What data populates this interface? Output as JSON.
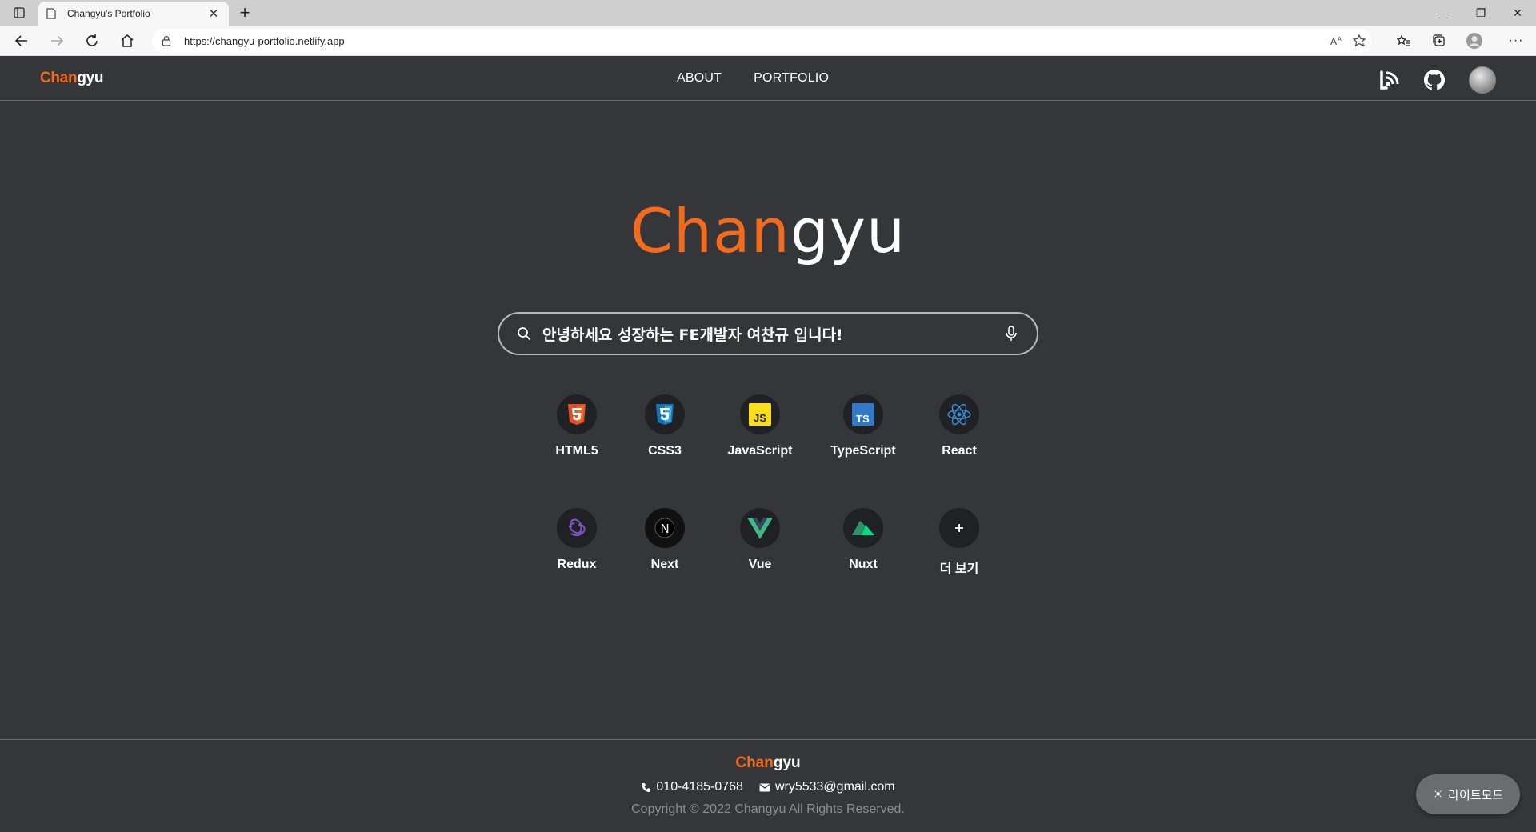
{
  "browser": {
    "tab_title": "Changyu's Portfolio",
    "url": "https://changyu-portfolio.netlify.app"
  },
  "header": {
    "logo_orange": "Chan",
    "logo_white": "gyu",
    "nav": [
      "ABOUT",
      "PORTFOLIO"
    ]
  },
  "hero": {
    "logo_orange": "Chan",
    "logo_white": "gyu",
    "search_value": "안녕하세요 성장하는 FE개발자 여찬규 입니다!"
  },
  "skills": [
    {
      "name": "HTML5",
      "icon": "html5-icon"
    },
    {
      "name": "CSS3",
      "icon": "css3-icon"
    },
    {
      "name": "JavaScript",
      "icon": "javascript-icon"
    },
    {
      "name": "TypeScript",
      "icon": "typescript-icon"
    },
    {
      "name": "React",
      "icon": "react-icon"
    },
    {
      "name": "Redux",
      "icon": "redux-icon"
    },
    {
      "name": "Next",
      "icon": "next-icon"
    },
    {
      "name": "Vue",
      "icon": "vue-icon"
    },
    {
      "name": "Nuxt",
      "icon": "nuxt-icon"
    },
    {
      "name": "더 보기",
      "icon": "plus-icon"
    }
  ],
  "footer": {
    "logo_orange": "Chan",
    "logo_white": "gyu",
    "phone": "010-4185-0768",
    "email": "wry5533@gmail.com",
    "copyright": "Copyright © 2022 Changyu All Rights Reserved."
  },
  "mode_button": {
    "icon": "☀",
    "label": "라이트모드"
  },
  "colors": {
    "brand_orange": "#f46b1b",
    "background": "#35363a",
    "icon_circle": "#202124"
  }
}
